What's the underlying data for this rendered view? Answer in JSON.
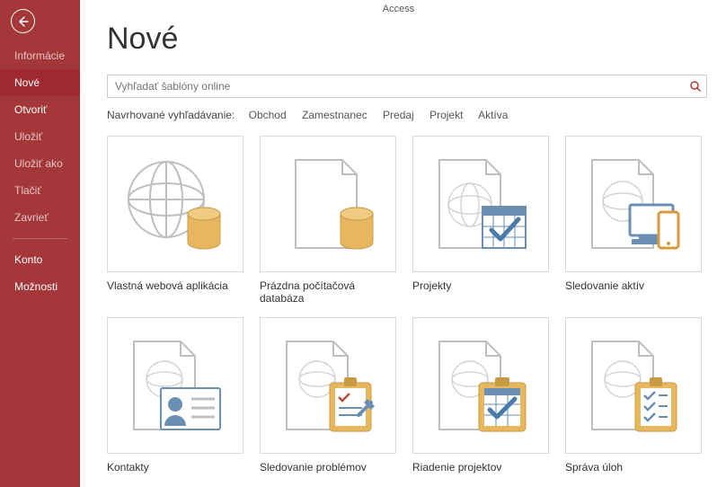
{
  "app_title": "Access",
  "page_title": "Nové",
  "sidebar": {
    "items": [
      {
        "label": "Informácie",
        "enabled": false,
        "active": false
      },
      {
        "label": "Nové",
        "enabled": true,
        "active": true
      },
      {
        "label": "Otvoriť",
        "enabled": true,
        "active": false
      },
      {
        "label": "Uložiť",
        "enabled": false,
        "active": false
      },
      {
        "label": "Uložiť ako",
        "enabled": false,
        "active": false
      },
      {
        "label": "Tlačiť",
        "enabled": false,
        "active": false
      },
      {
        "label": "Zavrieť",
        "enabled": false,
        "active": false
      }
    ],
    "footer": [
      {
        "label": "Konto"
      },
      {
        "label": "Možnosti"
      }
    ]
  },
  "search": {
    "placeholder": "Vyhľadať šablóny online"
  },
  "suggested": {
    "label": "Navrhované vyhľadávanie:",
    "keywords": [
      "Obchod",
      "Zamestnanec",
      "Predaj",
      "Projekt",
      "Aktíva"
    ]
  },
  "templates": [
    {
      "name": "Vlastná webová aplikácia",
      "icon": "globe-db"
    },
    {
      "name": "Prázdna počítačová databáza",
      "icon": "doc-db"
    },
    {
      "name": "Projekty",
      "icon": "doc-calendar-check"
    },
    {
      "name": "Sledovanie aktív",
      "icon": "doc-devices"
    },
    {
      "name": "Kontakty",
      "icon": "doc-contact-card"
    },
    {
      "name": "Sledovanie problémov",
      "icon": "doc-clipboard-issues"
    },
    {
      "name": "Riadenie projektov",
      "icon": "doc-clipboard-calendar"
    },
    {
      "name": "Správa úloh",
      "icon": "doc-clipboard-tasks"
    }
  ]
}
